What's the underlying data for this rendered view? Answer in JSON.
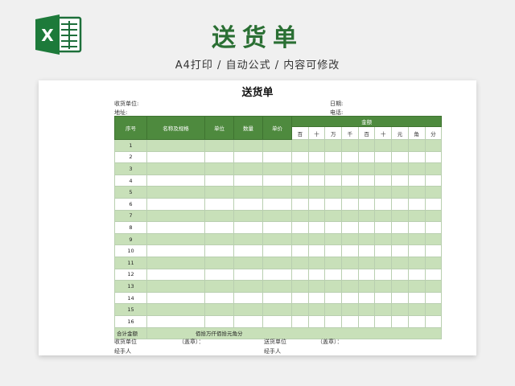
{
  "banner": {
    "title": "送货单",
    "subtitle": "A4打印 / 自动公式 / 内容可修改",
    "logo_letter": "X"
  },
  "colors": {
    "brand_green": "#2a6f33",
    "header_green": "#4e8a3e",
    "row_green": "#c8e0b9"
  },
  "document": {
    "title": "送货单",
    "receiver_label": "收货单位:",
    "date_label": "日期:",
    "address_label": "地址:",
    "phone_label": "电话:"
  },
  "table": {
    "headers": {
      "seq": "序号",
      "name": "名称及规格",
      "unit": "单位",
      "qty": "数量",
      "price": "单价",
      "amount": "金额"
    },
    "digits": [
      "百",
      "十",
      "万",
      "千",
      "百",
      "十",
      "元",
      "角",
      "分"
    ],
    "rows": [
      "1",
      "2",
      "3",
      "4",
      "5",
      "6",
      "7",
      "8",
      "9",
      "10",
      "11",
      "12",
      "13",
      "14",
      "15",
      "16"
    ],
    "total_label": "合计金额",
    "total_words": "佰拾万仟佰拾元角分"
  },
  "footer": {
    "receiver_unit": "收货单位",
    "receiver_seal": "（盖章）：",
    "sender_unit": "送货单位",
    "sender_seal": "（盖章）：",
    "handler1": "经手人",
    "handler2": "经手人"
  }
}
